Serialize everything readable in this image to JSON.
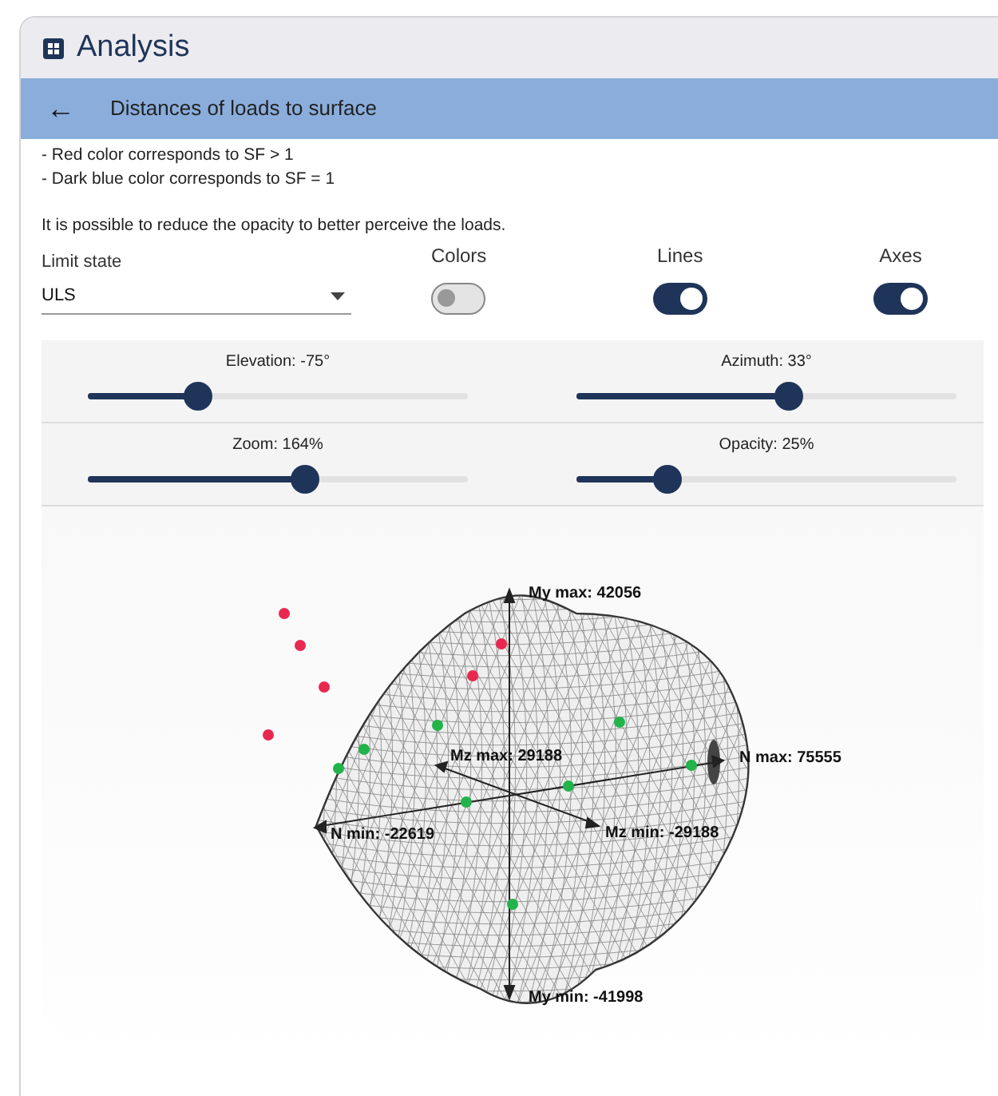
{
  "header": {
    "title": "Analysis"
  },
  "subheader": {
    "back": "←",
    "title": "Distances of loads to surface"
  },
  "notes": [
    "- Red color corresponds to SF > 1",
    "- Dark blue color corresponds to SF = 1"
  ],
  "hint": "It is possible to reduce the opacity to better perceive the loads.",
  "limit_state": {
    "label": "Limit state",
    "value": "ULS"
  },
  "toggles": [
    {
      "label": "Colors",
      "on": false
    },
    {
      "label": "Lines",
      "on": true
    },
    {
      "label": "Axes",
      "on": true
    }
  ],
  "sliders": [
    {
      "label": "Elevation: -75°",
      "level": 0.29
    },
    {
      "label": "Azimuth: 33°",
      "level": 0.56
    },
    {
      "label": "Zoom: 164%",
      "level": 0.57
    },
    {
      "label": "Opacity: 25%",
      "level": 0.24
    }
  ],
  "viewer": {
    "axis_labels": [
      "My max: 42056",
      "N max: 75555",
      "Mz max: 29188",
      "N min: -22619",
      "Mz min: -29188",
      "My min: -41998"
    ]
  }
}
